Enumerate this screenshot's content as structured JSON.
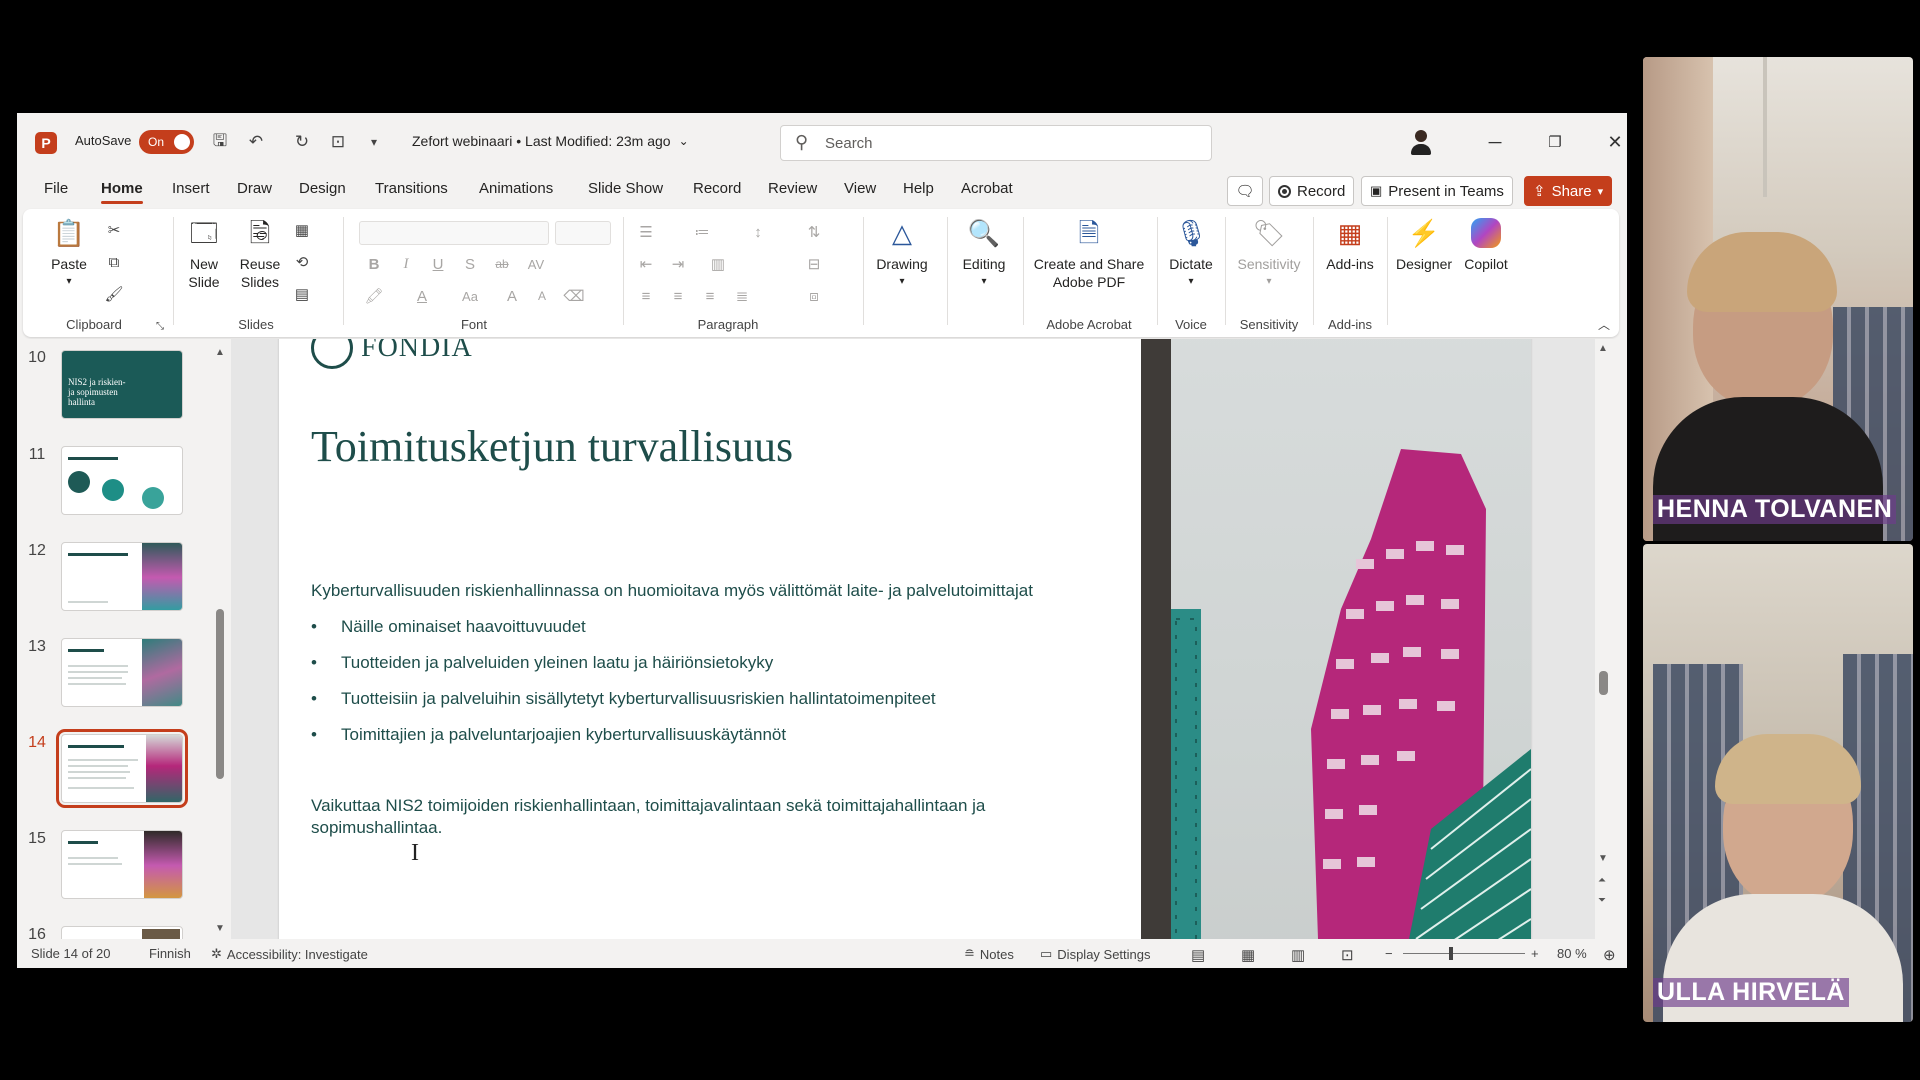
{
  "window": {
    "app_icon": "P",
    "autosave_label": "AutoSave",
    "autosave_state": "On",
    "doc_title": "Zefort webinaari • Last Modified: 23m ago",
    "search_placeholder": "Search"
  },
  "tabs": [
    "File",
    "Home",
    "Insert",
    "Draw",
    "Design",
    "Transitions",
    "Animations",
    "Slide Show",
    "Record",
    "Review",
    "View",
    "Help",
    "Acrobat"
  ],
  "top_buttons": {
    "record": "Record",
    "present": "Present in Teams",
    "share": "Share"
  },
  "ribbon": {
    "paste": "Paste",
    "new_slide": "New Slide",
    "reuse_slides": "Reuse Slides",
    "drawing": "Drawing",
    "editing": "Editing",
    "create_pdf": "Create and Share Adobe PDF",
    "dictate": "Dictate",
    "sensitivity": "Sensitivity",
    "addins": "Add-ins",
    "designer": "Designer",
    "copilot": "Copilot",
    "groups": {
      "clipboard": "Clipboard",
      "slides": "Slides",
      "font": "Font",
      "paragraph": "Paragraph",
      "adobe": "Adobe Acrobat",
      "voice": "Voice",
      "sensitivity": "Sensitivity",
      "addins": "Add-ins"
    },
    "font_buttons": {
      "bold": "B",
      "italic": "I",
      "underline": "U",
      "strike": "S",
      "strikethrough": "ab",
      "spacing": "AV",
      "case": "Aa",
      "grow": "A",
      "shrink": "A"
    }
  },
  "thumbnails": [
    {
      "num": "10",
      "text": "NIS2 ja riskien- ja sopimusten hallinta"
    },
    {
      "num": "11",
      "text": ""
    },
    {
      "num": "12",
      "text": ""
    },
    {
      "num": "13",
      "text": ""
    },
    {
      "num": "14",
      "text": ""
    },
    {
      "num": "15",
      "text": ""
    },
    {
      "num": "16",
      "text": ""
    }
  ],
  "slide": {
    "logo": "FONDIA",
    "title": "Toimitusketjun turvallisuus",
    "intro": "Kyberturvallisuuden riskienhallinnassa on huomioitava myös välittömät laite- ja palvelutoimittajat",
    "bullets": [
      "Näille ominaiset haavoittuvuudet",
      "Tuotteiden ja palveluiden yleinen laatu ja häiriönsietokyky",
      "Tuotteisiin ja palveluihin sisällytetyt kyberturvallisuusriskien hallintatoimenpiteet",
      "Toimittajien ja palveluntarjoajien kyberturvallisuuskäytännöt"
    ],
    "bullet_char": "•",
    "closing_line1": "Vaikuttaa NIS2 toimijoiden riskienhallintaan, toimittajavalintaan sekä toimittajahallintaan ja",
    "closing_line2": "sopimushallintaa."
  },
  "status": {
    "slide_count": "Slide 14 of 20",
    "language": "Finnish",
    "accessibility": "Accessibility: Investigate",
    "notes": "Notes",
    "display_settings": "Display Settings",
    "zoom": "80 %"
  },
  "participants": [
    {
      "name": "HENNA TOLVANEN"
    },
    {
      "name": "ULLA HIRVELÄ"
    }
  ],
  "colors": {
    "accent": "#c43e1c",
    "slide_text": "#1e4d4a",
    "building_magenta": "#b5277a"
  }
}
